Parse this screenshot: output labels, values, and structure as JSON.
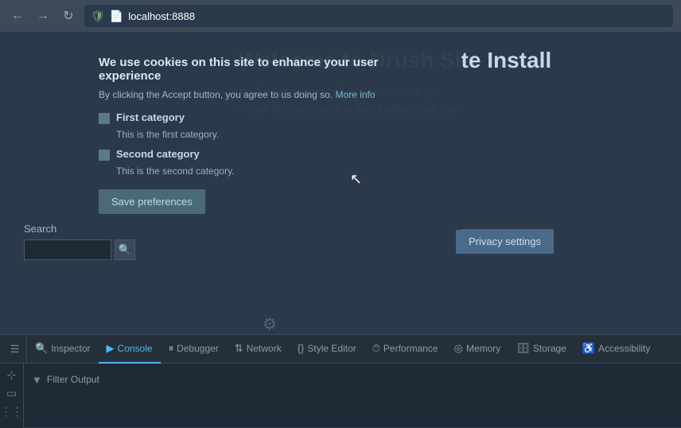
{
  "browser": {
    "url": "localhost:8888",
    "back_label": "←",
    "forward_label": "→",
    "reload_label": "↻"
  },
  "cookie_banner": {
    "title": "We use cookies on this site to enhance your user experience",
    "description": "By clicking the Accept button, you agree to us doing so.",
    "more_info_label": "More info",
    "categories": [
      {
        "id": "first",
        "label": "First category",
        "description": "This is the first category."
      },
      {
        "id": "second",
        "label": "Second category",
        "description": "This is the second category."
      }
    ],
    "save_button_label": "Save preferences"
  },
  "privacy_settings_btn": "Privacy settings",
  "main_page": {
    "title": "Welcome to Drush Site Install",
    "no_content_text": "No front page content has been created yet.",
    "follow_text": "Follow the",
    "user_guide_label": "User Guide",
    "to_start_text": "to start building your site."
  },
  "search": {
    "label": "Search",
    "placeholder": ""
  },
  "devtools": {
    "tabs": [
      {
        "id": "inspector",
        "label": "Inspector",
        "icon": "🔍",
        "active": false
      },
      {
        "id": "console",
        "label": "Console",
        "icon": "▶",
        "active": true
      },
      {
        "id": "debugger",
        "label": "Debugger",
        "icon": "⏸",
        "active": false
      },
      {
        "id": "network",
        "label": "Network",
        "icon": "↕",
        "icon_sym": "⇅",
        "active": false
      },
      {
        "id": "style-editor",
        "label": "Style Editor",
        "icon": "{}",
        "active": false
      },
      {
        "id": "performance",
        "label": "Performance",
        "icon": "⏱",
        "active": false
      },
      {
        "id": "memory",
        "label": "Memory",
        "icon": "◎",
        "active": false
      },
      {
        "id": "storage",
        "label": "Storage",
        "icon": "🗄",
        "active": false
      },
      {
        "id": "accessibility",
        "label": "Accessibility",
        "icon": "♿",
        "active": false
      }
    ],
    "filter_label": "Filter Output"
  }
}
